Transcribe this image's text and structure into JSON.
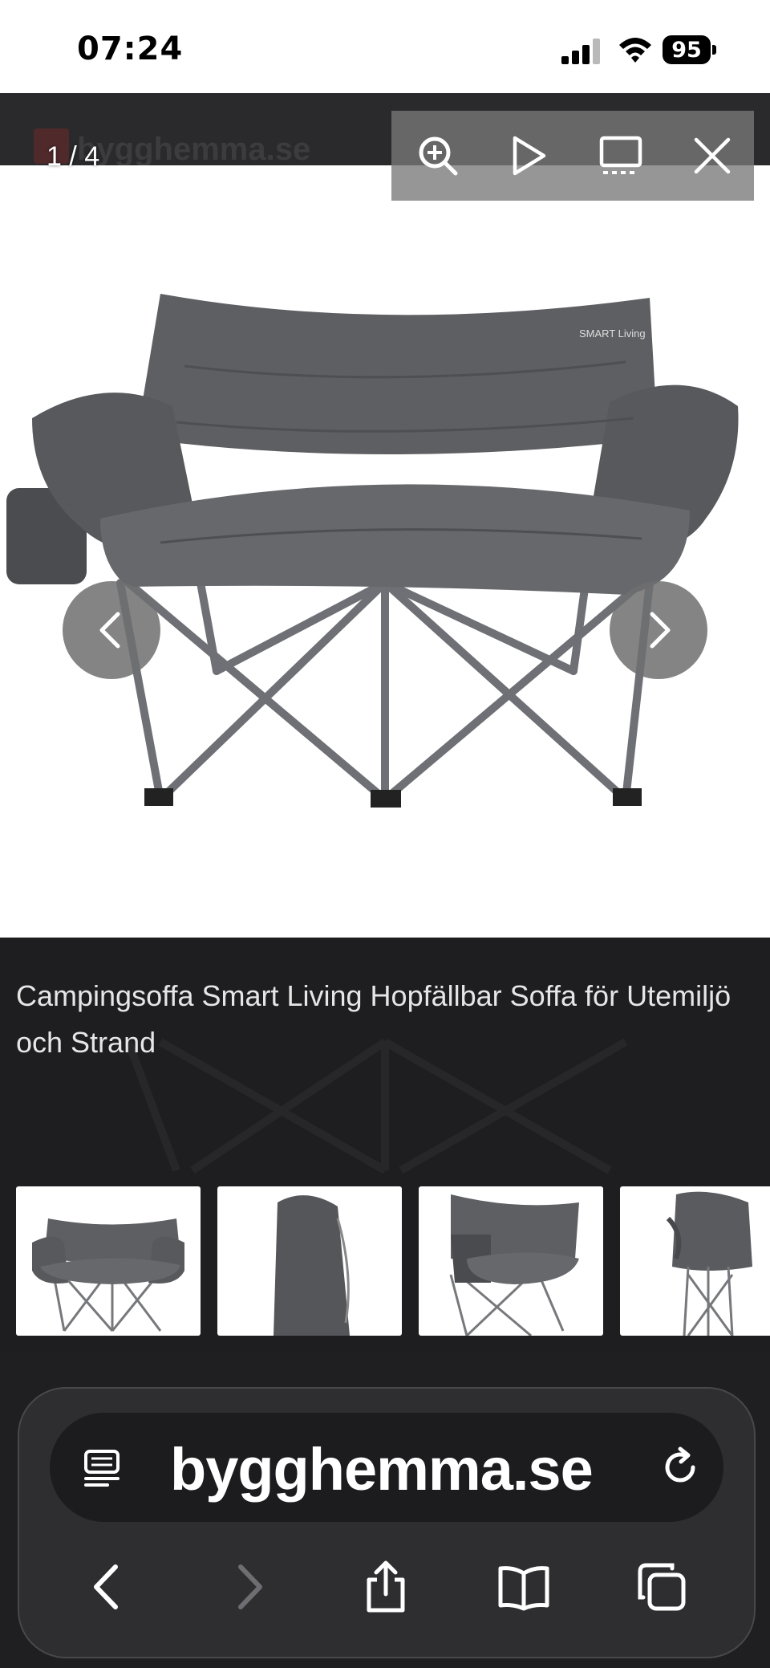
{
  "status_bar": {
    "time": "07:24",
    "battery": "95"
  },
  "site": {
    "logo_text": "bygghemma.se"
  },
  "lightbox": {
    "counter": "1 / 4",
    "toolbar": {
      "zoom_icon": "zoom-in-icon",
      "play_icon": "play-icon",
      "thumbnails_icon": "thumbnails-icon",
      "close_icon": "close-icon"
    },
    "prev_icon": "chevron-left-icon",
    "next_icon": "chevron-right-icon",
    "caption": "Campingsoffa Smart Living Hopfällbar Soffa för Utemiljö och Strand",
    "image_badge": "SMART Living",
    "thumbnails": [
      "sofa-front",
      "carry-bag",
      "sofa-side",
      "sofa-folded"
    ]
  },
  "browser": {
    "url": "bygghemma.se",
    "page_icon": "page-menu-icon",
    "reload_icon": "reload-icon",
    "buttons": [
      "back-icon",
      "forward-icon",
      "share-icon",
      "bookmarks-icon",
      "tabs-icon"
    ]
  },
  "colors": {
    "overlay_bg": "#1f1f21",
    "sofa_fabric": "#5e5e62",
    "frame": "#6f7075"
  }
}
